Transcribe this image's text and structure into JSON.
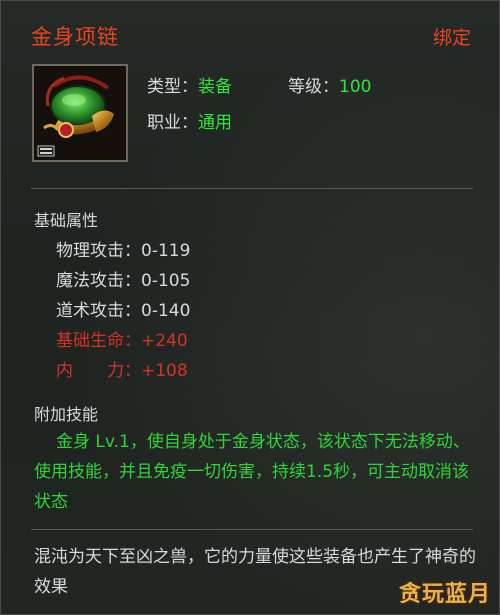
{
  "item": {
    "name": "金身项链",
    "bind_status": "绑定",
    "type_label": "类型：",
    "type_value": "装备",
    "level_label": "等级：",
    "level_value": "100",
    "class_label": "职业：",
    "class_value": "通用",
    "icon": "green-gold-necklace-icon"
  },
  "base_attributes": {
    "heading": "基础属性",
    "stats": [
      {
        "label": "物理攻击：",
        "value": "0-119",
        "color": "#d9d9d9"
      },
      {
        "label": "魔法攻击：",
        "value": "0-105",
        "color": "#d9d9d9"
      },
      {
        "label": "道术攻击：",
        "value": "0-140",
        "color": "#d9d9d9"
      },
      {
        "label": "基础生命：",
        "value": "+240",
        "color": "#d63223"
      },
      {
        "label": "内　　力：",
        "value": "+108",
        "color": "#d63223"
      }
    ]
  },
  "extra_skill": {
    "heading": "附加技能",
    "description": "金身 Lv.1，使自身处于金身状态，该状态下无法移动、使用技能，并且免疫一切伤害，持续1.5秒，可主动取消该状态"
  },
  "lore": "混沌为天下至凶之兽，它的力量使这些装备也产生了神奇的效果",
  "watermark": {
    "text": "贪玩蓝月"
  },
  "colors": {
    "title": "#e8441f",
    "positive_value": "#2fe63a",
    "special_stat": "#d63223",
    "text": "#d9d9d9",
    "background": "#1f2320"
  }
}
